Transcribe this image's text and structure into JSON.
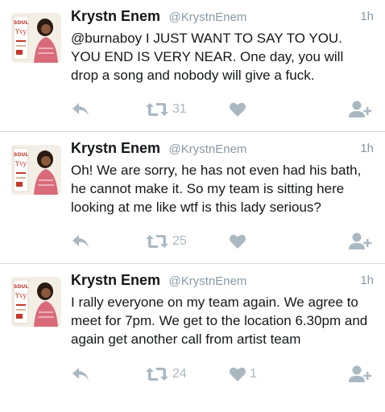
{
  "tweets": [
    {
      "name": "Krystn Enem",
      "handle": "@KrystnEnem",
      "time": "1h",
      "text": "@burnaboy I JUST WANT TO SAY TO YOU. YOU END IS VERY NEAR. One day, you will drop a song and nobody will give a fuck.",
      "retweets": "31",
      "likes": ""
    },
    {
      "name": "Krystn Enem",
      "handle": "@KrystnEnem",
      "time": "1h",
      "text": "Oh! We are sorry, he has not even had his bath, he cannot make it. So my team is sitting here looking at me like wtf is this lady serious?",
      "retweets": "25",
      "likes": ""
    },
    {
      "name": "Krystn Enem",
      "handle": "@KrystnEnem",
      "time": "1h",
      "text": "I rally everyone on my team again. We agree to meet for 7pm. We get to the location 6.30pm and again get another call from artist team",
      "retweets": "24",
      "likes": "1"
    }
  ],
  "avatar": {
    "text_top": "SOUL",
    "text_mid": "Yvy",
    "colors": {
      "bg": "#f3efe7",
      "accent": "#c0392b",
      "dress": "#d96a7a",
      "hair": "#2b1a12"
    }
  },
  "icons": {
    "reply": "reply-icon",
    "retweet": "retweet-icon",
    "like": "heart-icon",
    "follow": "follow-icon"
  },
  "colors": {
    "text": "#14171a",
    "muted": "#8899a6",
    "icon": "#aab8c2",
    "divider": "#d6d9dc"
  }
}
